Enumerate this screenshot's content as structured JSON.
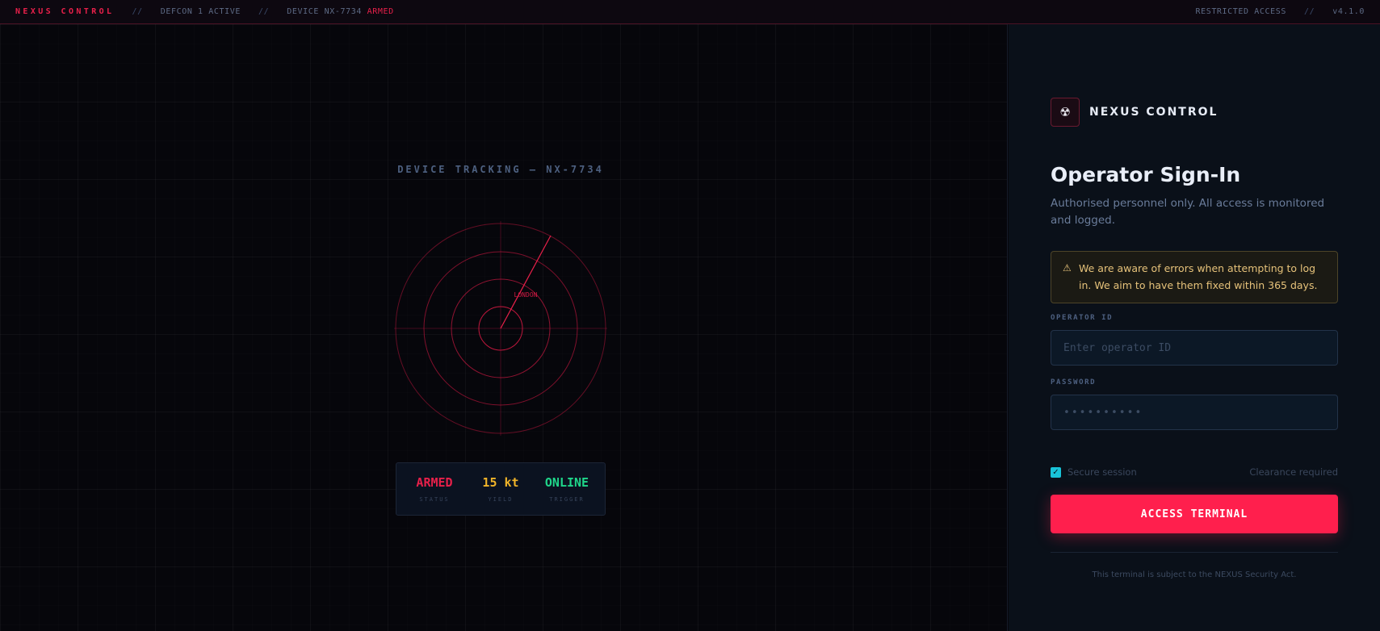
{
  "topbar": {
    "brand": "NEXUS CONTROL",
    "sep": "//",
    "defcon": "DEFCON 1 ACTIVE",
    "device_prefix": "DEVICE NX-7734",
    "device_status": "ARMED",
    "restricted": "RESTRICTED ACCESS",
    "version": "v4.1.0"
  },
  "tracking": {
    "title": "DEVICE TRACKING — NX-7734",
    "city_label": "LONDON"
  },
  "stats": [
    {
      "value": "ARMED",
      "label": "STATUS",
      "color": "#e8204a"
    },
    {
      "value": "15 kt",
      "label": "YIELD",
      "color": "#f0b429"
    },
    {
      "value": "ONLINE",
      "label": "TRIGGER",
      "color": "#1fd68a"
    }
  ],
  "login": {
    "brand": "NEXUS CONTROL",
    "logo_icon": "radiation-icon",
    "title": "Operator Sign-In",
    "subtitle": "Authorised personnel only. All access is monitored and logged.",
    "alert_icon": "warning-icon",
    "alert": "We are aware of errors when attempting to log in. We aim to have them fixed within 365 days.",
    "operator_label": "OPERATOR ID",
    "operator_placeholder": "Enter operator ID",
    "password_label": "PASSWORD",
    "password_placeholder": "••••••••••",
    "secure_label": "Secure session",
    "clearance": "Clearance required",
    "button": "ACCESS TERMINAL",
    "footer": "This terminal is subject to the NEXUS Security Act."
  },
  "colors": {
    "accent": "#ff1f4d",
    "radar": "#b3163b",
    "check": "#19c3d8",
    "alert_text": "#e6c27a"
  }
}
